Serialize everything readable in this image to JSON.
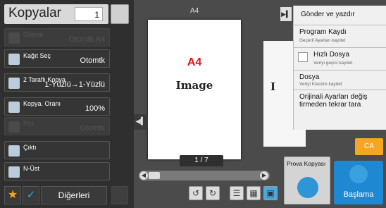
{
  "header": {
    "title": "Kopyalar",
    "copies": "1"
  },
  "functions": [
    {
      "label": "Orijinal",
      "value": "Otomtk  A4",
      "enabled": false
    },
    {
      "label": "Kağıt Seç",
      "value": "Otomtk",
      "enabled": true
    },
    {
      "label": "2 Taraflı Kopya",
      "value": "1-Yüzlü→1-Yüzlü",
      "enabled": true
    },
    {
      "label": "Kopya. Oranı",
      "value": "100%",
      "enabled": true
    },
    {
      "label": "Poz",
      "value": "Otomtk",
      "enabled": false
    },
    {
      "label": "Çıktı",
      "value": "",
      "enabled": true
    },
    {
      "label": "N-Üst",
      "value": "",
      "enabled": true
    }
  ],
  "bottom": {
    "others": "Diğerleri"
  },
  "preview": {
    "paper_label": "A4",
    "page_title": "A4",
    "page_image": "Image",
    "page2_image": "I",
    "pager": "1 / 7"
  },
  "menu": {
    "send_print": "Gönder ve yazdır",
    "program": "Program Kaydı",
    "program_sub": "Geçerli Ayarları kaydet",
    "quick_file": "Hızlı Dosya",
    "quick_file_sub": "Veriyi geçici kaydet",
    "file": "Dosya",
    "file_sub": "Veriyi Klasöre kaydet",
    "original_change": "Orijinali Ayarları değiş tirmeden tekrar tara"
  },
  "actions": {
    "ca": "CA",
    "proof": "Prova Kopyası",
    "start": "Başlama"
  },
  "colors": {
    "accent": "#1e88d3",
    "ca": "#f5a623",
    "red": "#e8101a"
  }
}
